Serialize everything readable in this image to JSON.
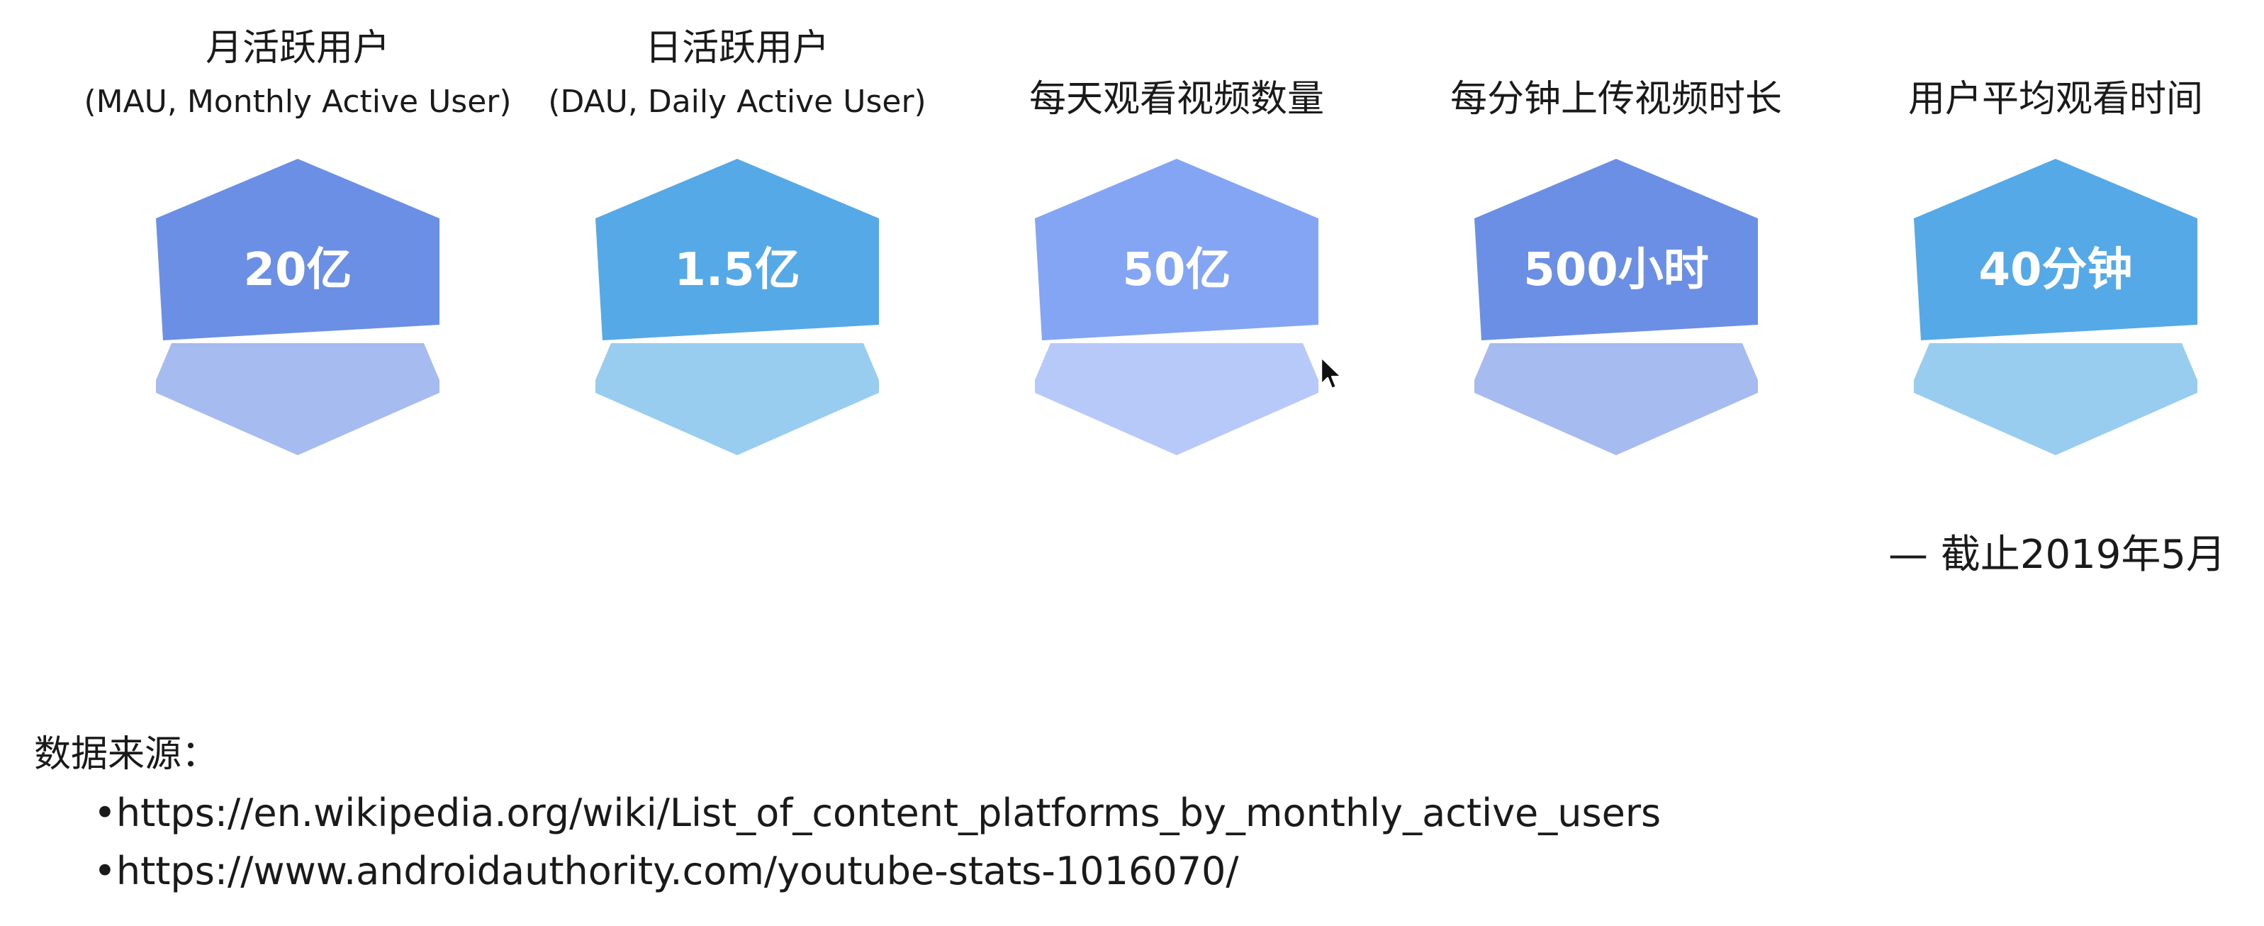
{
  "stats": [
    {
      "label": "月活跃用户",
      "sub": "(MAU, Monthly Active User)",
      "value": "20亿",
      "color_top": "#6b8fe5",
      "color_bottom": "#a6bbef"
    },
    {
      "label": "日活跃用户",
      "sub": "(DAU, Daily Active User)",
      "value": "1.5亿",
      "color_top": "#55a9e6",
      "color_bottom": "#98cdf0"
    },
    {
      "label": "每天观看视频数量",
      "sub": "",
      "value": "50亿",
      "color_top": "#84a4f4",
      "color_bottom": "#b7c9f8"
    },
    {
      "label": "每分钟上传视频时长",
      "sub": "",
      "value": "500小时",
      "color_top": "#6b8fe5",
      "color_bottom": "#a6bbef"
    },
    {
      "label": "用户平均观看时间",
      "sub": "",
      "value": "40分钟",
      "color_top": "#55a9e6",
      "color_bottom": "#98cdf0"
    }
  ],
  "note": "— 截止2019年5月",
  "sources": {
    "title": "数据来源：",
    "links": [
      "•https://en.wikipedia.org/wiki/List_of_content_platforms_by_monthly_active_users",
      "•https://www.androidauthority.com/youtube-stats-1016070/"
    ]
  }
}
